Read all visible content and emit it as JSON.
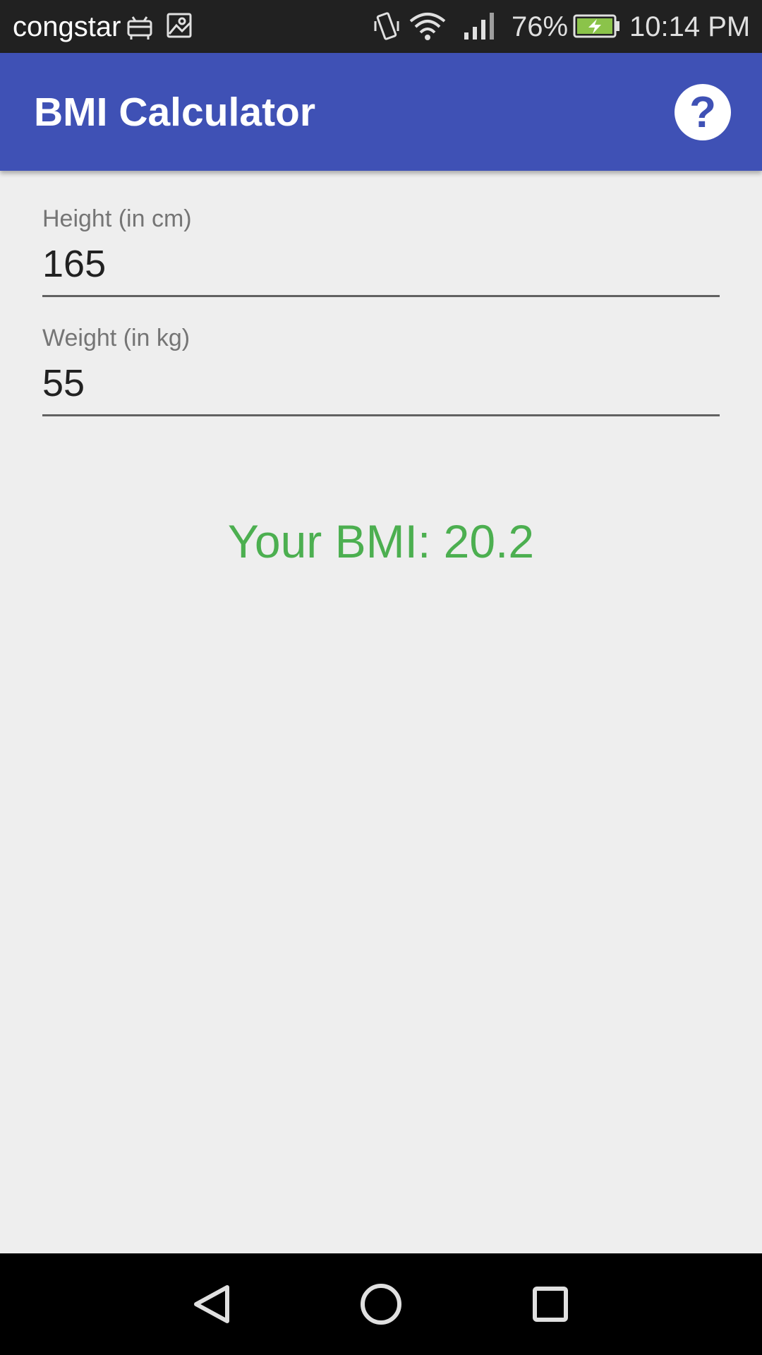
{
  "status_bar": {
    "carrier": "congstar",
    "battery_percent": "76%",
    "time": "10:14 PM",
    "icons": [
      "android-debug-icon",
      "image-icon",
      "vibrate-icon",
      "wifi-icon",
      "signal-icon",
      "battery-charging-icon"
    ]
  },
  "app_bar": {
    "title": "BMI Calculator",
    "help_icon": "help-icon",
    "help_glyph": "?"
  },
  "form": {
    "height_label": "Height (in cm)",
    "height_value": "165",
    "weight_label": "Weight (in kg)",
    "weight_value": "55"
  },
  "result": {
    "text": "Your BMI: 20.2",
    "color": "#4caf50"
  },
  "nav_bar": {
    "icons": [
      "back-icon",
      "home-icon",
      "recents-icon"
    ]
  },
  "colors": {
    "primary": "#3f51b5",
    "status_bar": "#212121",
    "background": "#eeeeee"
  }
}
